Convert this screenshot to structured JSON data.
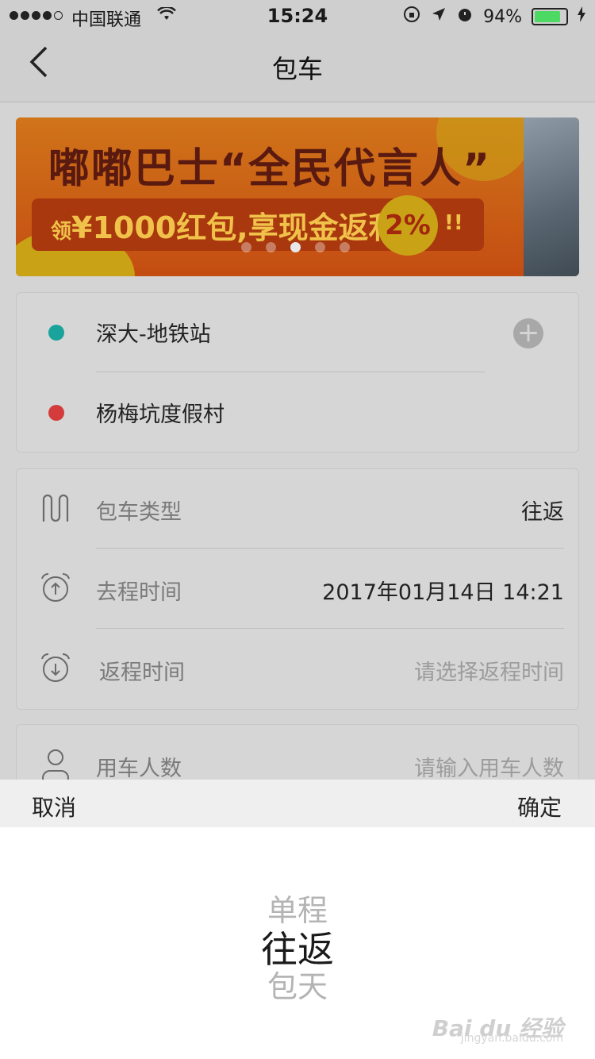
{
  "status_bar": {
    "carrier": "中国联通",
    "time": "15:24",
    "battery": "94%",
    "battery_level": 0.94
  },
  "nav": {
    "title": "包车"
  },
  "banner": {
    "headline": "嘟嘟巴士“全民代言人”",
    "sub_prefix": "领",
    "sub_main": "¥1000红包,享现金返利",
    "percent": "2%",
    "exclaim": "!!",
    "pages": 5,
    "active_page": 3
  },
  "route": {
    "start": "深大-地铁站",
    "end": "杨梅坑度假村",
    "start_color": "#1aa39a",
    "end_color": "#d43b3b"
  },
  "form": {
    "type_label": "包车类型",
    "type_value": "往返",
    "depart_label": "去程时间",
    "depart_value": "2017年01月14日 14:21",
    "return_label": "返程时间",
    "return_placeholder": "请选择返程时间",
    "people_label": "用车人数",
    "people_placeholder": "请输入用车人数"
  },
  "picker": {
    "cancel": "取消",
    "confirm": "确定",
    "options": [
      "单程",
      "往返",
      "包天"
    ],
    "selected": "往返"
  },
  "watermark": {
    "logo": "Bai du 经验",
    "url": "jingyan.baidu.com"
  }
}
